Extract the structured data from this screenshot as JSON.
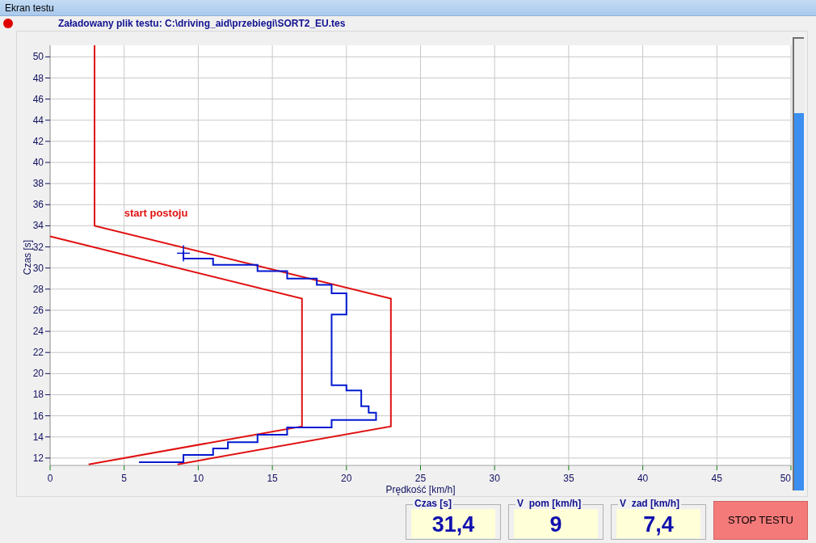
{
  "window": {
    "title": "Ekran testu"
  },
  "status": {
    "loaded_file": "Załadowany plik testu: C:\\driving_aid\\przebiegi\\SORT2_EU.tes"
  },
  "chart": {
    "chart_data": {
      "type": "line",
      "xlabel": "Prędkość [km/h]",
      "ylabel": "Czas [s]",
      "xlim": [
        0,
        50
      ],
      "ylim": [
        11.3,
        51.1
      ],
      "xticks": [
        0,
        5,
        10,
        15,
        20,
        25,
        30,
        35,
        40,
        45,
        50
      ],
      "grid": true,
      "yticks": [
        12,
        14,
        16,
        18,
        20,
        22,
        24,
        26,
        28,
        30,
        32,
        34,
        36,
        38,
        40,
        42,
        44,
        46,
        48,
        50
      ],
      "series": [
        {
          "color": "#e01010",
          "x": [
            3,
            3,
            23,
            23,
            8.6
          ],
          "values": [
            51.1,
            34,
            27.1,
            15,
            11.4
          ]
        },
        {
          "color": "#e01010",
          "x": [
            0,
            17,
            17,
            2.6
          ],
          "values": [
            33,
            27.1,
            15,
            11.4
          ]
        },
        {
          "color": "#0018d0",
          "x": [
            6,
            9,
            9,
            11,
            11,
            12,
            12,
            14,
            14,
            16,
            16,
            19,
            19,
            22,
            22,
            21.5,
            21.5,
            21,
            21,
            20,
            20,
            19,
            19,
            20,
            20,
            19,
            19,
            18,
            18,
            16,
            16,
            14,
            14,
            11,
            11,
            9,
            9
          ],
          "values": [
            11.6,
            11.6,
            12.3,
            12.3,
            12.9,
            12.9,
            13.5,
            13.5,
            14.2,
            14.2,
            14.9,
            14.9,
            15.6,
            15.6,
            16.3,
            16.3,
            16.9,
            16.9,
            18.4,
            18.4,
            18.9,
            18.9,
            25.6,
            25.6,
            27.6,
            27.6,
            28.4,
            28.4,
            29,
            29,
            29.7,
            29.7,
            30.3,
            30.3,
            30.9,
            30.9,
            31.6
          ]
        }
      ],
      "annotations": [
        "start postoju"
      ]
    },
    "progress": {
      "level": 0.835
    }
  },
  "readouts": [
    {
      "label": "Czas [s]",
      "value": "31,4"
    },
    {
      "label": "V  pom [km/h]",
      "value": "9"
    },
    {
      "label": "V  zad [km/h]",
      "value": "7,4"
    }
  ],
  "stop_button": {
    "label": "STOP TESTU"
  }
}
